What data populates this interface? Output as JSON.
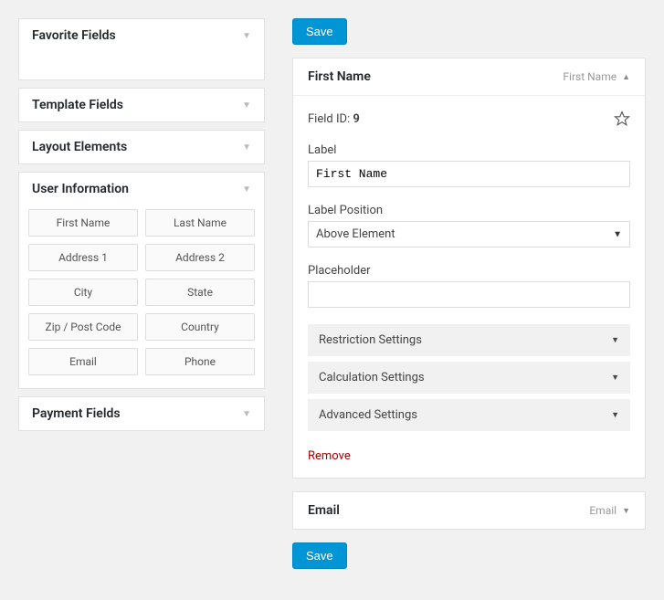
{
  "sidebar": {
    "sections": {
      "favorite": {
        "title": "Favorite Fields"
      },
      "template": {
        "title": "Template Fields"
      },
      "layout": {
        "title": "Layout Elements"
      },
      "user_info": {
        "title": "User Information",
        "fields": [
          "First Name",
          "Last Name",
          "Address 1",
          "Address 2",
          "City",
          "State",
          "Zip / Post Code",
          "Country",
          "Email",
          "Phone"
        ]
      },
      "payment": {
        "title": "Payment Fields"
      }
    }
  },
  "main": {
    "save_label": "Save",
    "active_field": {
      "title": "First Name",
      "type_label": "First Name",
      "field_id_label": "Field ID:",
      "field_id_value": "9",
      "label_label": "Label",
      "label_value": "First Name",
      "label_position_label": "Label Position",
      "label_position_value": "Above Element",
      "placeholder_label": "Placeholder",
      "placeholder_value": "",
      "settings": {
        "restriction": "Restriction Settings",
        "calculation": "Calculation Settings",
        "advanced": "Advanced Settings"
      },
      "remove_label": "Remove"
    },
    "collapsed_field": {
      "title": "Email",
      "type_label": "Email"
    }
  }
}
